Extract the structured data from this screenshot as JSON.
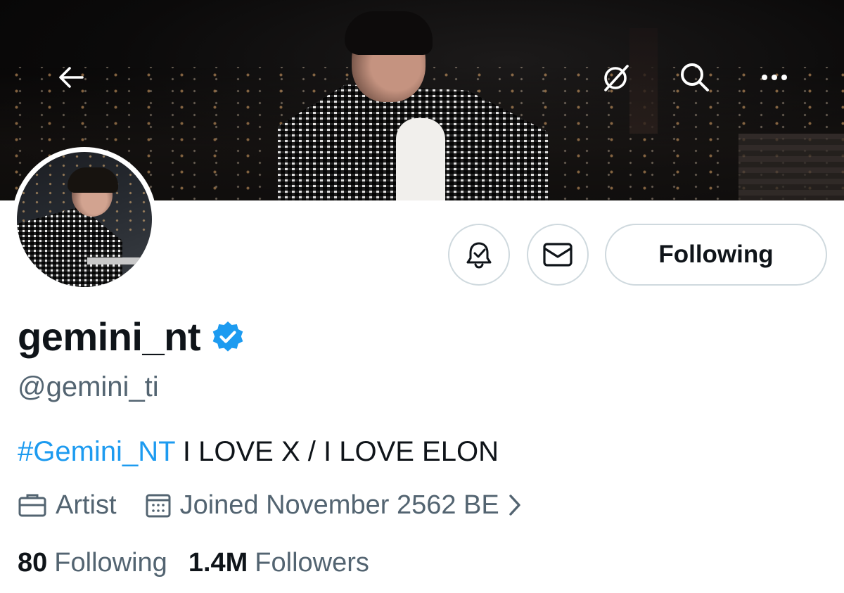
{
  "header": {
    "back_icon": "arrow-left-icon",
    "grok_icon": "grok-icon",
    "search_icon": "search-icon",
    "more_icon": "more-dots-icon"
  },
  "profile": {
    "display_name": "gemini_nt",
    "verified": true,
    "handle": "@gemini_ti",
    "bio_hashtag": "#Gemini_NT",
    "bio_text": " I LOVE X / I LOVE ELON",
    "profession": "Artist",
    "joined": "Joined November 2562 BE",
    "following_count": "80",
    "following_label": "Following",
    "followers_count": "1.4M",
    "followers_label": "Followers"
  },
  "actions": {
    "notify_icon": "bell-check-icon",
    "message_icon": "envelope-icon",
    "follow_label": "Following"
  },
  "colors": {
    "accent": "#1d9bf0",
    "secondary_text": "#536471",
    "primary_text": "#0f1419",
    "border": "#cfd9de"
  }
}
